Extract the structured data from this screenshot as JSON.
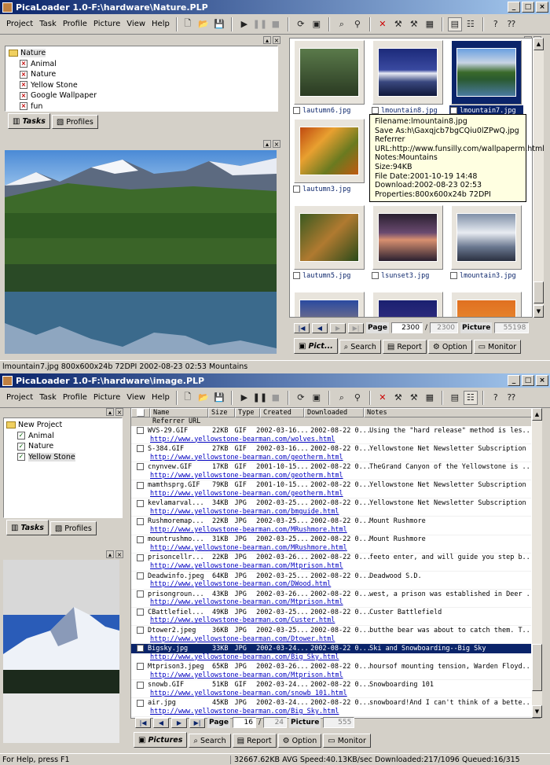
{
  "window1": {
    "title": "PicaLoader 1.0-F:\\hardware\\Nature.PLP",
    "menu": [
      "Project",
      "Task",
      "Profile",
      "Picture",
      "View",
      "Help"
    ],
    "tree": {
      "root": "Nature",
      "items": [
        "Animal",
        "Nature",
        "Yellow Stone",
        "Google Wallpaper",
        "fun"
      ]
    },
    "tabs": [
      "Tasks",
      "Profiles"
    ],
    "thumbs": [
      "lautumn6.jpg",
      "lmountain8.jpg",
      "lmountain7.jpg",
      "lautumn3.jpg",
      "lautumn5.jpg",
      "lsunset3.jpg",
      "lmountain3.jpg"
    ],
    "tooltip": [
      "Filename:lmountain8.jpg",
      "Save As:h\\Gaxqjcb7bgCQiu0lZPwQ.jpg",
      "Referrer",
      "URL:http://www.funsilly.com/wallpaperm.html",
      "Notes:Mountains",
      "Size:94KB",
      "File Date:2001-10-19 14:48",
      "Download:2002-08-23 02:53",
      "Properties:800x600x24b 72DPI"
    ],
    "pager": {
      "page_label": "Page",
      "page": "2300",
      "total": "2300",
      "picture_label": "Picture",
      "picture": "55198"
    },
    "bottom_tabs": [
      "Pict...",
      "Search",
      "Report",
      "Option",
      "Monitor"
    ],
    "status": "lmountain7.jpg 800x600x24b 72DPI 2002-08-23 02:53 Mountains"
  },
  "window2": {
    "title": "PicaLoader 1.0-F:\\hardware\\image.PLP",
    "menu": [
      "Project",
      "Task",
      "Profile",
      "Picture",
      "View",
      "Help"
    ],
    "tree": {
      "root": "New Project",
      "items": [
        "Animal",
        "Nature",
        "Yellow Stone"
      ]
    },
    "tabs": [
      "Tasks",
      "Profiles"
    ],
    "columns": [
      "Name",
      "Size",
      "Type",
      "Created",
      "Downloaded",
      "Notes"
    ],
    "subcolumn": "Referrer URL",
    "rows": [
      {
        "name": "WVS-29.GIF",
        "size": "22KB",
        "type": "GIF",
        "created": "2002-03-16...",
        "downloaded": "2002-08-22 0...",
        "notes": "Using the \"hard release\" method is les...",
        "url": "http://www.yellowstone-bearman.com/wolves.html"
      },
      {
        "name": "S-384.GIF",
        "size": "27KB",
        "type": "GIF",
        "created": "2002-03-16...",
        "downloaded": "2002-08-22 0...",
        "notes": "Yellowstone Net Newsletter Subscription",
        "url": "http://www.yellowstone-bearman.com/geotherm.html"
      },
      {
        "name": "cnynvew.GIF",
        "size": "17KB",
        "type": "GIF",
        "created": "2001-10-15...",
        "downloaded": "2002-08-22 0...",
        "notes": "TheGrand Canyon of the Yellowstone is ...",
        "url": "http://www.yellowstone-bearman.com/geotherm.html"
      },
      {
        "name": "mamthsprg.GIF",
        "size": "79KB",
        "type": "GIF",
        "created": "2001-10-15...",
        "downloaded": "2002-08-22 0...",
        "notes": "Yellowstone Net Newsletter Subscription",
        "url": "http://www.yellowstone-bearman.com/geotherm.html"
      },
      {
        "name": "kevlamarval...",
        "size": "34KB",
        "type": "JPG",
        "created": "2002-03-25...",
        "downloaded": "2002-08-22 0...",
        "notes": "Yellowstone Net Newsletter Subscription",
        "url": "http://www.yellowstone-bearman.com/bmguide.html"
      },
      {
        "name": "Rushmoremap...",
        "size": "22KB",
        "type": "JPG",
        "created": "2002-03-25...",
        "downloaded": "2002-08-22 0...",
        "notes": "Mount Rushmore",
        "url": "http://www.yellowstone-bearman.com/MRushmore.html"
      },
      {
        "name": "mountrushmo...",
        "size": "31KB",
        "type": "JPG",
        "created": "2002-03-25...",
        "downloaded": "2002-08-22 0...",
        "notes": "Mount Rushmore",
        "url": "http://www.yellowstone-bearman.com/MRushmore.html"
      },
      {
        "name": "prisoncellr...",
        "size": "22KB",
        "type": "JPG",
        "created": "2002-03-26...",
        "downloaded": "2002-08-22 0...",
        "notes": "feeto enter, and will guide you step b...",
        "url": "http://www.yellowstone-bearman.com/Mtprison.html"
      },
      {
        "name": "Deadwinfo.jpeg",
        "size": "64KB",
        "type": "JPG",
        "created": "2002-03-25...",
        "downloaded": "2002-08-22 0...",
        "notes": "Deadwood S.D.",
        "url": "http://www.yellowstone-bearman.com/DWood.html"
      },
      {
        "name": "prisongroun...",
        "size": "43KB",
        "type": "JPG",
        "created": "2002-03-26...",
        "downloaded": "2002-08-22 0...",
        "notes": "west, a prison was established in Deer ...",
        "url": "http://www.yellowstone-bearman.com/Mtprison.html"
      },
      {
        "name": "CBattlefiel...",
        "size": "49KB",
        "type": "JPG",
        "created": "2002-03-25...",
        "downloaded": "2002-08-22 0...",
        "notes": "Custer Battlefield",
        "url": "http://www.yellowstone-bearman.com/Custer.html"
      },
      {
        "name": "Dtower2.jpeg",
        "size": "36KB",
        "type": "JPG",
        "created": "2002-03-25...",
        "downloaded": "2002-08-22 0...",
        "notes": "butthe bear was about to catch them. T...",
        "url": "http://www.yellowstone-bearman.com/Dtower.html"
      },
      {
        "name": "Bigsky.jpg",
        "size": "33KB",
        "type": "JPG",
        "created": "2002-03-24...",
        "downloaded": "2002-08-22 0...",
        "notes": "Ski and Snowboarding--Big Sky",
        "url": "http://www.yellowstone-bearman.com/Big_Sky.html"
      },
      {
        "name": "Mtprison3.jpeg",
        "size": "65KB",
        "type": "JPG",
        "created": "2002-03-26...",
        "downloaded": "2002-08-22 0...",
        "notes": "hoursof mounting tension, Warden Floyd...",
        "url": "http://www.yellowstone-bearman.com/Mtprison.html"
      },
      {
        "name": "snowb.GIF",
        "size": "51KB",
        "type": "GIF",
        "created": "2002-03-24...",
        "downloaded": "2002-08-22 0...",
        "notes": "Snowboarding 101",
        "url": "http://www.yellowstone-bearman.com/snowb_101.html"
      },
      {
        "name": "air.jpg",
        "size": "45KB",
        "type": "JPG",
        "created": "2002-03-24...",
        "downloaded": "2002-08-22 0...",
        "notes": "snowboard!And I can't think of a bette...",
        "url": "http://www.yellowstone-bearman.com/Big_Sky.html"
      }
    ],
    "selected_row": 12,
    "pager": {
      "page_label": "Page",
      "page": "16",
      "total": "24",
      "picture_label": "Picture",
      "picture": "555"
    },
    "bottom_tabs": [
      "Pictures",
      "Search",
      "Report",
      "Option",
      "Monitor"
    ],
    "status_left": "For Help, press F1",
    "status_right": "32667.62KB AVG Speed:40.13KB/sec Downloaded:217/1096 Queued:16/315"
  }
}
